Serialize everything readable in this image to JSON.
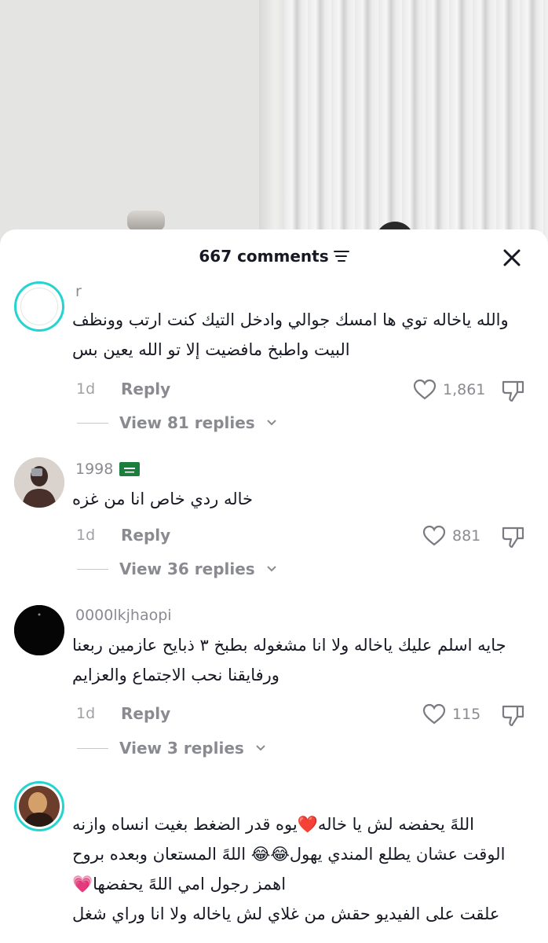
{
  "header": {
    "comment_count": "667 comments",
    "icons": {
      "sort": "filter-lines-icon",
      "close": "close-icon"
    }
  },
  "colors": {
    "accent_ring": "#25d4d0",
    "heart": "#e6245e",
    "text": "#161823",
    "muted": "#8a8b91"
  },
  "comments": [
    {
      "username": "r",
      "lines": [
        "والله ياخاله توي ها امسك جوالي وادخل التيك كنت ارتب وونظف",
        "البيت واطبخ مافضيت إلا تو الله يعين بس"
      ],
      "time": "1d",
      "reply_label": "Reply",
      "likes": "1,861",
      "view_replies": "View 81 replies"
    },
    {
      "username": "1998",
      "username_flag": "saudi-flag-icon",
      "lines": [
        "خاله ردي خاص انا من غزه"
      ],
      "time": "1d",
      "reply_label": "Reply",
      "likes": "881",
      "view_replies": "View 36 replies"
    },
    {
      "username": "0000lkjhaopi",
      "lines": [
        "جايه اسلم عليك ياخاله ولا انا مشغوله بطبخ ٣ ذبايح عازمين ربعنا",
        "ورفايقنا نحب الاجتماع والعزايم"
      ],
      "time": "1d",
      "reply_label": "Reply",
      "likes": "115",
      "view_replies": "View 3 replies"
    },
    {
      "username": "",
      "lines": [
        "اللهً يحفضه لش يا خاله❤️يوه قدر الضغط بغيت انساه وازنه",
        "الوقت عشان يطلع المندي يهول😂😂 اللهً المستعان وبعده بروح",
        "اهمز رجول امي اللهً يحفضها💗",
        "علقت على الفيديو حقش من غلاي لش ياخاله ولا انا وراي شغل"
      ]
    }
  ]
}
